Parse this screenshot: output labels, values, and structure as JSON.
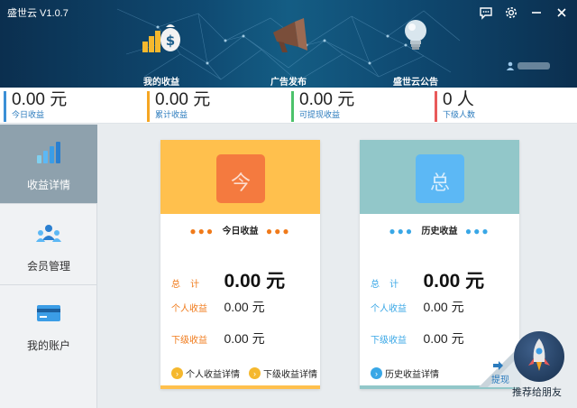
{
  "window": {
    "title": "盛世云 V1.0.7",
    "icons": [
      "chat-icon",
      "gear-icon",
      "minimize-icon",
      "close-icon"
    ]
  },
  "nav": [
    {
      "label": "我的收益",
      "icon": "money-bag-icon"
    },
    {
      "label": "广告发布",
      "icon": "megaphone-icon"
    },
    {
      "label": "盛世云公告",
      "icon": "lightbulb-icon"
    }
  ],
  "user": {
    "icon": "user-icon"
  },
  "stats": [
    {
      "value": "0.00 元",
      "label": "今日收益",
      "color": "#3b8fd6"
    },
    {
      "value": "0.00 元",
      "label": "累计收益",
      "color": "#f5a623"
    },
    {
      "value": "0.00 元",
      "label": "可提现收益",
      "color": "#4cc26b"
    },
    {
      "value": "0 人",
      "label": "下级人数",
      "color": "#e85a5a"
    }
  ],
  "sidebar": [
    {
      "label": "收益详情",
      "icon": "bar-chart-icon",
      "active": true
    },
    {
      "label": "会员管理",
      "icon": "members-icon",
      "active": false
    },
    {
      "label": "我的账户",
      "icon": "credit-card-icon",
      "active": false
    }
  ],
  "today_card": {
    "badge": "今",
    "heading": "今日收益",
    "total_label": "总    计",
    "total_value": "0.00 元",
    "personal_label": "个人收益",
    "personal_value": "0.00 元",
    "sub_label": "下级收益",
    "sub_value": "0.00 元",
    "link1": "个人收益详情",
    "link2": "下级收益详情",
    "color": "#ffc04d",
    "badge_color": "#f47a3f",
    "accent": "#f07a1a"
  },
  "history_card": {
    "badge": "总",
    "heading": "历史收益",
    "total_label": "总    计",
    "total_value": "0.00 元",
    "personal_label": "个人收益",
    "personal_value": "0.00 元",
    "sub_label": "下级收益",
    "sub_value": "0.00 元",
    "link1": "历史收益详情",
    "color": "#92c7c9",
    "badge_color": "#5cb8f5",
    "accent": "#39a7e6"
  },
  "withdraw_label": "提现",
  "recommend_label": "推荐给朋友"
}
